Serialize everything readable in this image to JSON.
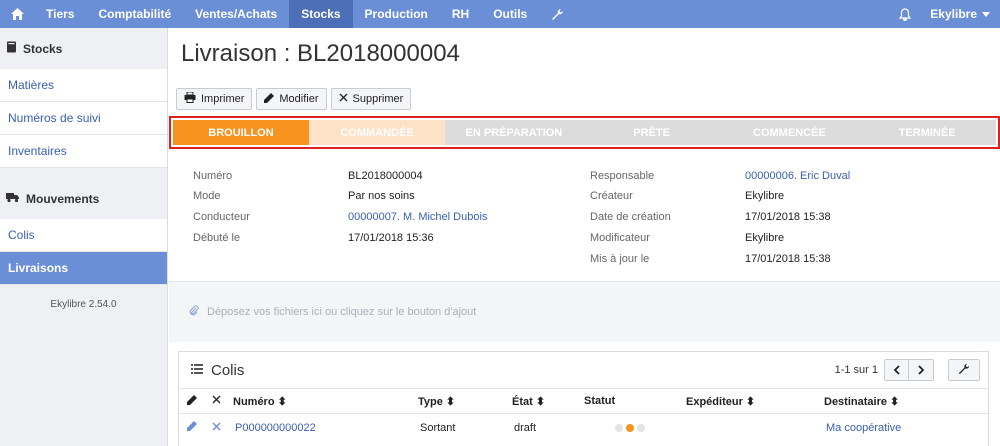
{
  "nav": {
    "items": [
      "Tiers",
      "Comptabilité",
      "Ventes/Achats",
      "Stocks",
      "Production",
      "RH",
      "Outils"
    ],
    "active": "Stocks",
    "user": "Ekylibre"
  },
  "sidebar": {
    "stocks_header": "Stocks",
    "stocks_items": [
      "Matières",
      "Numéros de suivi",
      "Inventaires"
    ],
    "movements_header": "Mouvements",
    "movements_items": [
      "Colis",
      "Livraisons"
    ],
    "active": "Livraisons",
    "version": "Ekylibre 2.54.0"
  },
  "page": {
    "title": "Livraison : BL2018000004"
  },
  "toolbar": {
    "print": "Imprimer",
    "edit": "Modifier",
    "delete": "Supprimer"
  },
  "states": [
    "BROUILLON",
    "COMMANDÉE",
    "EN PRÉPARATION",
    "PRÊTE",
    "COMMENCÉE",
    "TERMINÉE"
  ],
  "details": {
    "left": [
      {
        "label": "Numéro",
        "value": "BL2018000004",
        "link": false
      },
      {
        "label": "Mode",
        "value": "Par nos soins",
        "link": false
      },
      {
        "label": "Conducteur",
        "value": "00000007. M. Michel Dubois",
        "link": true
      },
      {
        "label": "Débuté le",
        "value": "17/01/2018 15:36",
        "link": false
      }
    ],
    "right": [
      {
        "label": "Responsable",
        "value": "00000006. Eric Duval",
        "link": true
      },
      {
        "label": "Créateur",
        "value": "Ekylibre",
        "link": false
      },
      {
        "label": "Date de création",
        "value": "17/01/2018 15:38",
        "link": false
      },
      {
        "label": "Modificateur",
        "value": "Ekylibre",
        "link": false
      },
      {
        "label": "Mis à jour le",
        "value": "17/01/2018 15:38",
        "link": false
      }
    ]
  },
  "dropzone": "Déposez vos fichiers ici ou cliquez sur le bouton d'ajout",
  "colis": {
    "title": "Colis",
    "pagination": "1-1 sur 1",
    "columns": [
      "Numéro",
      "Type",
      "État",
      "Statut",
      "Expéditeur",
      "Destinataire"
    ],
    "rows": [
      {
        "numero": "P000000000022",
        "type": "Sortant",
        "etat": "draft",
        "statut_active": 2,
        "expediteur": "",
        "destinataire": "Ma coopérative"
      }
    ]
  },
  "colors": {
    "nav": "#6a8fd6",
    "accent": "#f7931e",
    "link": "#3a5fb0"
  }
}
